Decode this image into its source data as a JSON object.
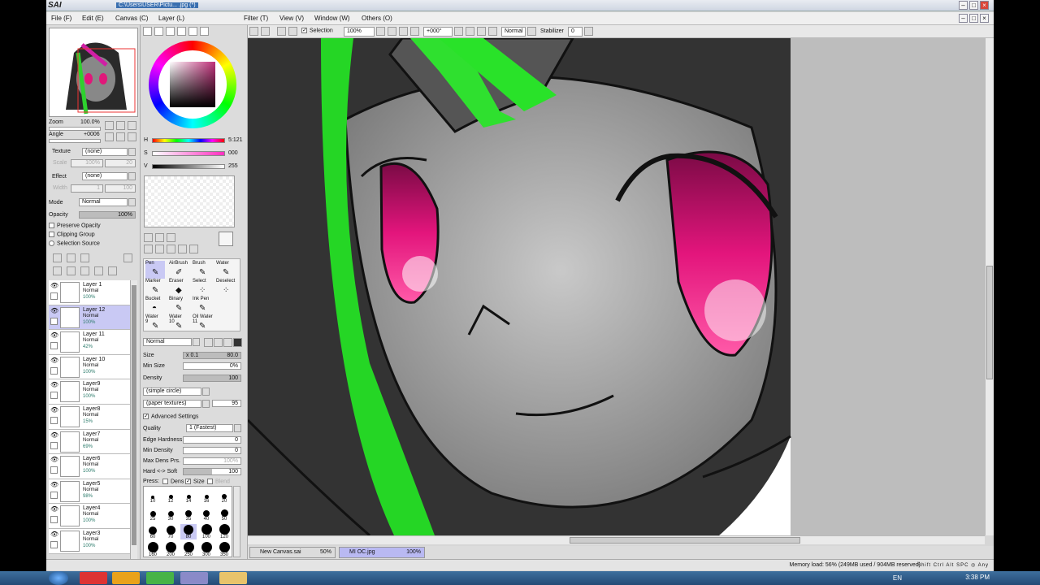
{
  "app": {
    "logo": "SAI",
    "path": "C:\\Users\\USER\\Pictu... .jpg (*)"
  },
  "menu": [
    "File (F)",
    "Edit (E)",
    "Canvas (C)",
    "Layer (L)",
    "Filter (T)",
    "View (V)",
    "Window (W)",
    "Others (O)"
  ],
  "toolbar": {
    "selection_label": "Selection",
    "zoom": "100%",
    "angle": "+000°",
    "blend": "Normal",
    "stabilizer_label": "Stabilizer",
    "stabilizer_value": "0"
  },
  "navigator": {
    "zoom_label": "Zoom",
    "zoom_value": "100.0%",
    "angle_label": "Angle",
    "angle_value": "+0006"
  },
  "left": {
    "texture_label": "Texture",
    "texture_value": "(none)",
    "scale_label": "Scale",
    "scale_value": "100%",
    "scale_num": "20",
    "effect_label": "Effect",
    "effect_value": "(none)",
    "width_label": "Width",
    "width_value": "1",
    "width_num": "100",
    "mode_label": "Mode",
    "mode_value": "Normal",
    "opacity_label": "Opacity",
    "opacity_value": "100%",
    "preserve_opacity": "Preserve Opacity",
    "clipping_group": "Clipping Group",
    "selection_source": "Selection Source"
  },
  "layers": [
    {
      "name": "Layer 1",
      "mode": "Normal",
      "opacity": "100%",
      "selected": false
    },
    {
      "name": "Layer 12",
      "mode": "Normal",
      "opacity": "100%",
      "selected": true
    },
    {
      "name": "Layer 11",
      "mode": "Normal",
      "opacity": "42%",
      "selected": false
    },
    {
      "name": "Layer 10",
      "mode": "Normal",
      "opacity": "100%",
      "selected": false
    },
    {
      "name": "Layer9",
      "mode": "Normal",
      "opacity": "100%",
      "selected": false
    },
    {
      "name": "Layer8",
      "mode": "Normal",
      "opacity": "15%",
      "selected": false
    },
    {
      "name": "Layer7",
      "mode": "Normal",
      "opacity": "69%",
      "selected": false
    },
    {
      "name": "Layer6",
      "mode": "Normal",
      "opacity": "100%",
      "selected": false
    },
    {
      "name": "Layer5",
      "mode": "Normal",
      "opacity": "98%",
      "selected": false
    },
    {
      "name": "Layer4",
      "mode": "Normal",
      "opacity": "100%",
      "selected": false
    },
    {
      "name": "Layer3",
      "mode": "Normal",
      "opacity": "100%",
      "selected": false
    }
  ],
  "color": {
    "h_label": "H",
    "h_value": "5:121",
    "s_label": "S",
    "s_value": "000",
    "v_label": "V",
    "v_value": "255"
  },
  "tools": [
    {
      "label": "Pen",
      "glyph": "✎",
      "selected": true
    },
    {
      "label": "AirBrush",
      "glyph": "✐",
      "selected": false
    },
    {
      "label": "Brush",
      "glyph": "✎",
      "selected": false
    },
    {
      "label": "Water",
      "glyph": "✎",
      "selected": false
    },
    {
      "label": "Marker",
      "glyph": "✎",
      "selected": false
    },
    {
      "label": "Eraser",
      "glyph": "◆",
      "selected": false
    },
    {
      "label": "Select",
      "glyph": "⁘",
      "selected": false
    },
    {
      "label": "Deselect",
      "glyph": "⁘",
      "selected": false
    },
    {
      "label": "Bucket",
      "glyph": "◓",
      "selected": false
    },
    {
      "label": "Binary",
      "glyph": "✎",
      "selected": false
    },
    {
      "label": "Ink Pen",
      "glyph": "✎",
      "selected": false
    },
    {
      "label": "",
      "glyph": "",
      "selected": false
    },
    {
      "label": "Water\n9",
      "glyph": "✎",
      "selected": false
    },
    {
      "label": "Water\n10",
      "glyph": "✎",
      "selected": false
    },
    {
      "label": "Oil Water\n11",
      "glyph": "✎",
      "selected": false
    },
    {
      "label": "",
      "glyph": "",
      "selected": false
    }
  ],
  "brush": {
    "blend": "Normal",
    "size_label": "Size",
    "size_mult": "x 0.1",
    "size_value": "80.0",
    "min_size_label": "Min Size",
    "min_size_value": "0%",
    "density_label": "Density",
    "density_value": "100",
    "shape": "(simple circle)",
    "texture": "(paper textures)",
    "texture_value": "95",
    "advanced": "Advanced Settings",
    "quality_label": "Quality",
    "quality_value": "1 (Fastest)",
    "edge_label": "Edge Hardness",
    "edge_value": "0",
    "min_density_label": "Min Density",
    "min_density_value": "0",
    "max_dens_label": "Max Dens Prs.",
    "max_dens_value": "100%",
    "hard_soft_label": "Hard <-> Soft",
    "hard_soft_value": "100",
    "press_label": "Press:",
    "press_dens": "Dens",
    "press_size": "Size",
    "press_blend": "Blend"
  },
  "brush_sizes": [
    "10",
    "12",
    "14",
    "16",
    "20",
    "25",
    "30",
    "35",
    "40",
    "50",
    "60",
    "70",
    "80",
    "100",
    "120",
    "160",
    "200",
    "250",
    "300",
    "350"
  ],
  "doc_tabs": [
    {
      "name": "New Canvas.sai",
      "zoom": "50%",
      "active": false
    },
    {
      "name": "MI OC.jpg",
      "zoom": "100%",
      "active": true
    }
  ],
  "status": {
    "memory": "Memory load: 56% (249MB used / 904MB reserved)",
    "keys": "Shift Ctrl Alt SPC ◎ Any"
  },
  "taskbar": {
    "lang": "EN",
    "time": "3:38 PM"
  }
}
